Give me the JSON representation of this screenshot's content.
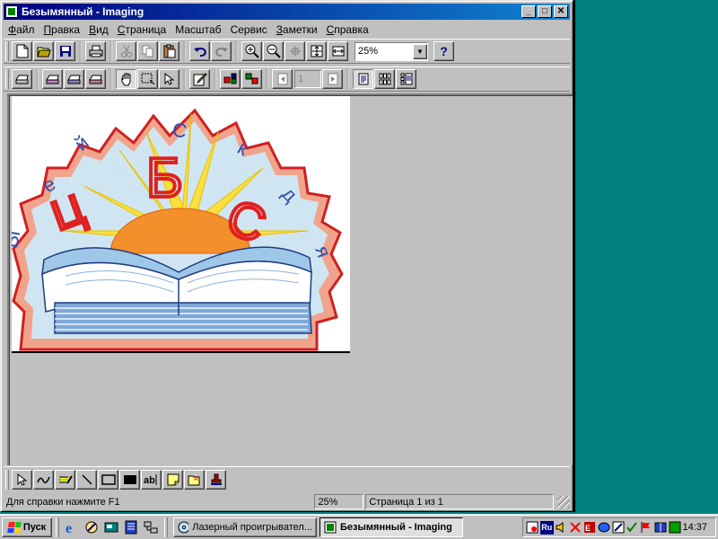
{
  "window": {
    "title": "Безымянный - Imaging",
    "controls": {
      "minimize": "_",
      "maximize": "□",
      "close": "✕"
    }
  },
  "menu": [
    {
      "label": "Файл",
      "accel": "Ф",
      "rest": "айл"
    },
    {
      "label": "Правка",
      "accel": "П",
      "rest": "равка"
    },
    {
      "label": "Вид",
      "accel": "В",
      "rest": "ид"
    },
    {
      "label": "Страница",
      "accel": "С",
      "rest": "траница"
    },
    {
      "label": "Масштаб",
      "accel": "М",
      "rest": "асштаб"
    },
    {
      "label": "Сервис",
      "accel": "С",
      "rest": "ервис"
    },
    {
      "label": "Заметки",
      "accel": "З",
      "rest": "аметки"
    },
    {
      "label": "Справка",
      "accel": "С",
      "rest": "правка"
    }
  ],
  "toolbar1": {
    "zoom_value": "25%",
    "help_label": "?"
  },
  "toolbar2": {
    "page_number": "1"
  },
  "statusbar": {
    "help_text": "Для справки нажмите F1",
    "zoom": "25%",
    "page_info": "Страница 1 из 1"
  },
  "taskbar": {
    "start_label": "Пуск",
    "tasks": [
      {
        "label": "Лазерный проигрывател...",
        "icon": "cd-player-icon"
      },
      {
        "label": "Безымянный - Imaging",
        "icon": "imaging-icon"
      }
    ],
    "tray_lang": "Ru",
    "clock": "14:37"
  },
  "image": {
    "letters": [
      "Б",
      "Ц",
      "С",
      "е",
      "й",
      "С",
      "к",
      "д",
      "я",
      "Ы"
    ]
  },
  "colors": {
    "titlebar_start": "#000080",
    "titlebar_end": "#1084d0",
    "desktop": "#008080",
    "face": "#c0c0c0"
  }
}
